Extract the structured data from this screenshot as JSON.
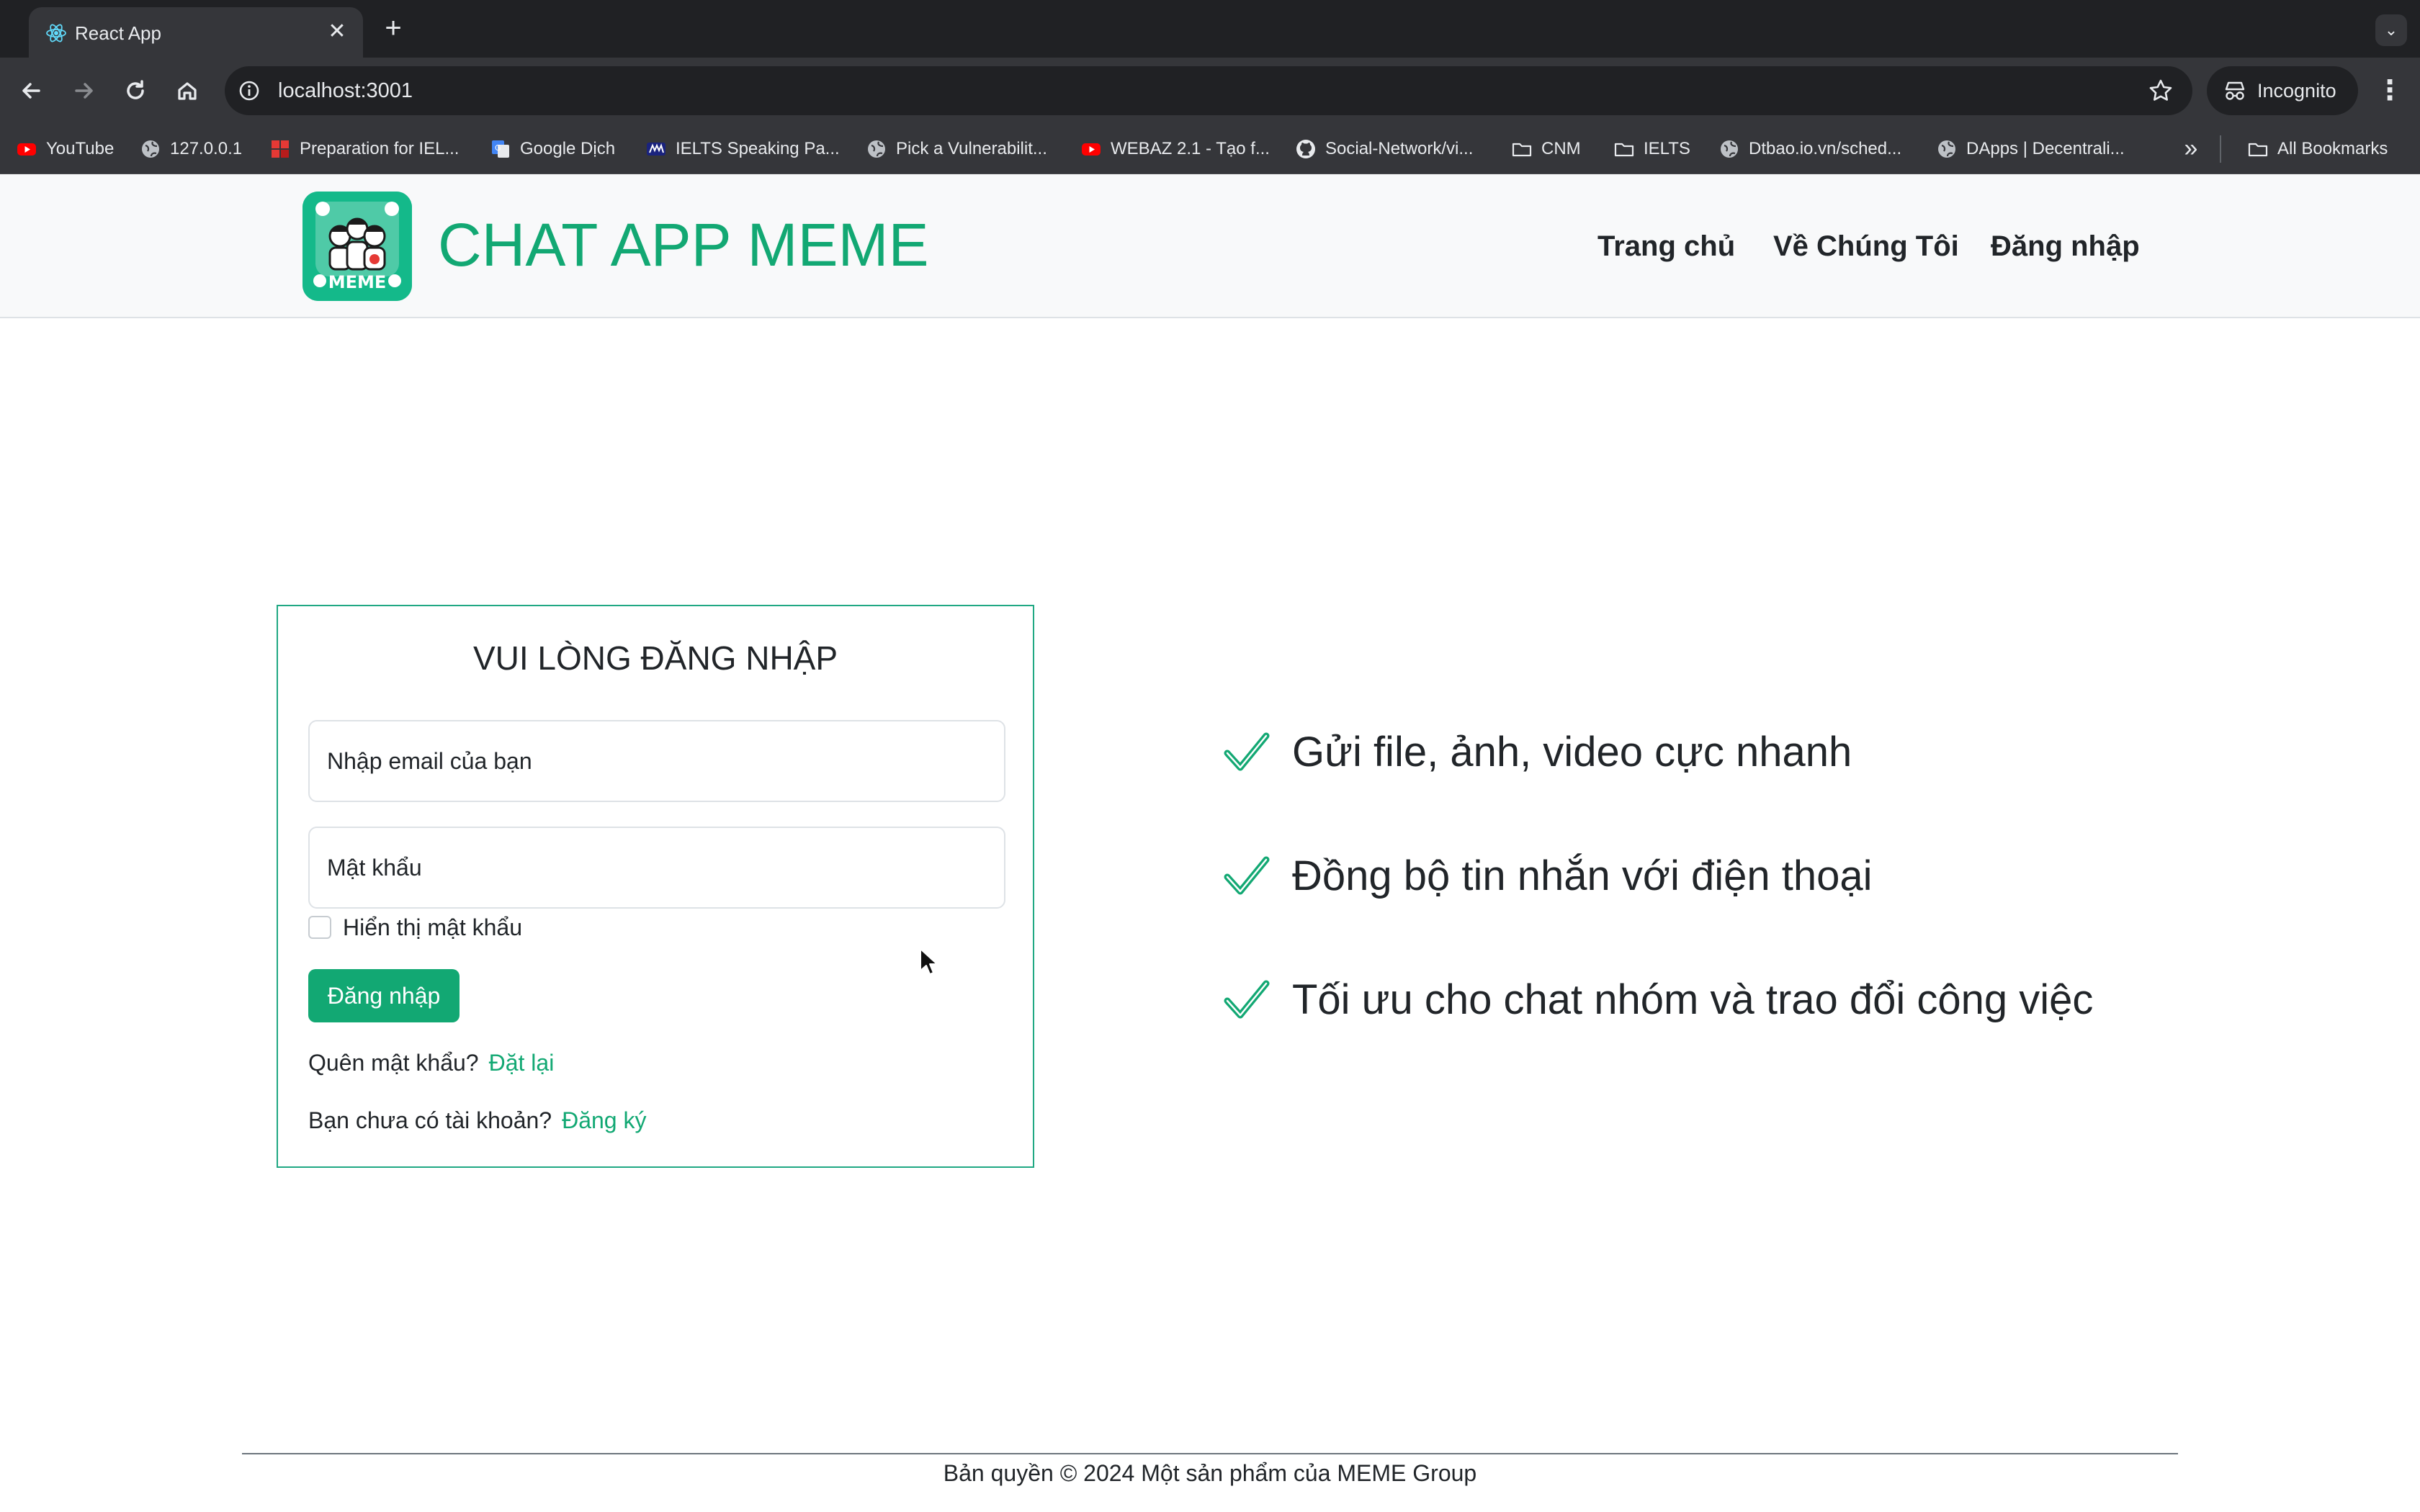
{
  "browser": {
    "tab_title": "React App",
    "new_tab_label": "+",
    "url": "localhost:3001",
    "incognito_label": "Incognito",
    "bookmarks": [
      {
        "label": "YouTube",
        "icon": "youtube-icon"
      },
      {
        "label": "127.0.0.1",
        "icon": "globe-icon"
      },
      {
        "label": "Preparation for IEL...",
        "icon": "red-grid-icon"
      },
      {
        "label": "Google Dịch",
        "icon": "google-translate-icon"
      },
      {
        "label": "IELTS Speaking Pa...",
        "icon": "ielts-icon"
      },
      {
        "label": "Pick a Vulnerabilit...",
        "icon": "globe-icon"
      },
      {
        "label": "WEBAZ 2.1 - Tạo f...",
        "icon": "youtube-icon"
      },
      {
        "label": "Social-Network/vi...",
        "icon": "github-icon"
      },
      {
        "label": "CNM",
        "icon": "folder-icon"
      },
      {
        "label": "IELTS",
        "icon": "folder-icon"
      },
      {
        "label": "Dtbao.io.vn/sched...",
        "icon": "globe-icon"
      },
      {
        "label": "DApps | Decentrali...",
        "icon": "globe-icon"
      }
    ],
    "all_bookmarks_label": "All Bookmarks"
  },
  "header": {
    "brand": "CHAT APP MEME",
    "logo_text": "MEME",
    "nav": [
      "Trang chủ",
      "Về Chúng Tôi",
      "Đăng nhập"
    ]
  },
  "login": {
    "title": "VUI LÒNG ĐĂNG NHẬP",
    "email_placeholder": "Nhập email của bạn",
    "password_placeholder": "Mật khẩu",
    "show_password_label": "Hiển thị mật khẩu",
    "submit_label": "Đăng nhập",
    "forgot_text": "Quên mật khẩu?",
    "reset_link": "Đặt lại",
    "no_account_text": "Bạn chưa có tài khoản?",
    "register_link": "Đăng ký"
  },
  "features": [
    "Gửi file, ảnh, video cực nhanh",
    "Đồng bộ tin nhắn với điện thoại",
    "Tối ưu cho chat nhóm và trao đổi công việc"
  ],
  "footer": {
    "copyright": "Bản quyền © 2024 Một sản phẩm của MEME Group"
  },
  "colors": {
    "brand_green": "#12a873",
    "chrome_dark": "#202124",
    "chrome_mid": "#35363a"
  }
}
